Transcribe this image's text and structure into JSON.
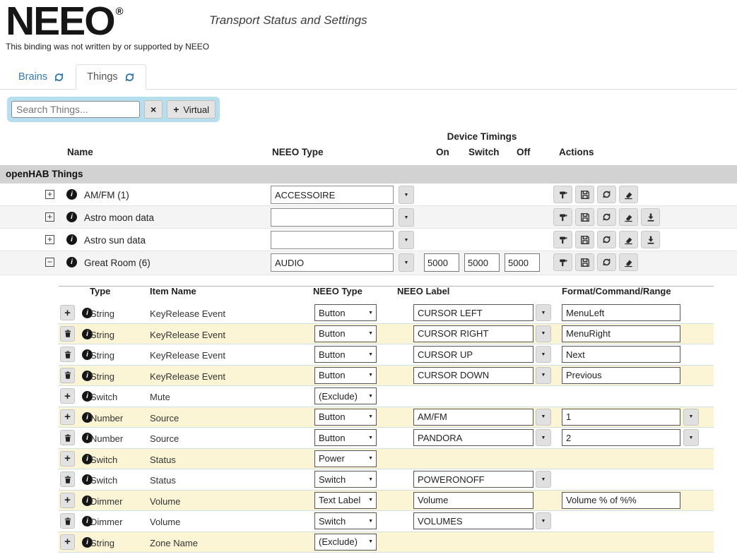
{
  "header": {
    "logo": "NEEO",
    "registered": "®",
    "subtitle": "Transport Status and Settings",
    "disclaimer": "This binding was not written by or supported by NEEO"
  },
  "tabs": {
    "brains": "Brains",
    "things": "Things"
  },
  "toolbar": {
    "search_placeholder": "Search Things...",
    "virtual_label": "Virtual"
  },
  "icons": {
    "add": "+",
    "clear": "×",
    "caret": "▼",
    "info": "i",
    "expand": "+",
    "collapse": "−",
    "action_icons": [
      "hammer-icon",
      "save-icon",
      "refresh-icon",
      "eraser-icon",
      "download-icon"
    ]
  },
  "things_table": {
    "headers": {
      "name": "Name",
      "neeo_type": "NEEO Type",
      "device_timings": "Device Timings",
      "on": "On",
      "switch": "Switch",
      "off": "Off",
      "actions": "Actions"
    },
    "section_label": "openHAB Things",
    "rows": [
      {
        "toggle": "+",
        "name": "AM/FM (1)",
        "neeo_type": "ACCESSOIRE",
        "has_download": false
      },
      {
        "toggle": "+",
        "name": "Astro moon data",
        "neeo_type": "",
        "has_download": true
      },
      {
        "toggle": "+",
        "name": "Astro sun data",
        "neeo_type": "",
        "has_download": true
      },
      {
        "toggle": "−",
        "name": "Great Room (6)",
        "neeo_type": "AUDIO",
        "has_download": false,
        "timing_on": "5000",
        "timing_switch": "5000",
        "timing_off": "5000"
      }
    ]
  },
  "channels_table": {
    "headers": {
      "type": "Type",
      "item_name": "Item Name",
      "neeo_type": "NEEO Type",
      "neeo_label": "NEEO Label",
      "format": "Format/Command/Range"
    },
    "rows": [
      {
        "action": "add",
        "type": "String",
        "item_name": "KeyRelease Event",
        "neeo_type": "Button",
        "neeo_label": "CURSOR LEFT",
        "label_dropdown": true,
        "format": "MenuLeft",
        "format_dropdown": false
      },
      {
        "action": "delete",
        "type": "String",
        "item_name": "KeyRelease Event",
        "neeo_type": "Button",
        "neeo_label": "CURSOR RIGHT",
        "label_dropdown": true,
        "format": "MenuRight",
        "format_dropdown": false
      },
      {
        "action": "delete",
        "type": "String",
        "item_name": "KeyRelease Event",
        "neeo_type": "Button",
        "neeo_label": "CURSOR UP",
        "label_dropdown": true,
        "format": "Next",
        "format_dropdown": false
      },
      {
        "action": "delete",
        "type": "String",
        "item_name": "KeyRelease Event",
        "neeo_type": "Button",
        "neeo_label": "CURSOR DOWN",
        "label_dropdown": true,
        "format": "Previous",
        "format_dropdown": false
      },
      {
        "action": "add",
        "type": "Switch",
        "item_name": "Mute",
        "neeo_type": "(Exclude)",
        "neeo_label": null,
        "label_dropdown": false,
        "format": null,
        "format_dropdown": false
      },
      {
        "action": "add",
        "type": "Number",
        "item_name": "Source",
        "neeo_type": "Button",
        "neeo_label": "AM/FM",
        "label_dropdown": true,
        "format": "1",
        "format_dropdown": true
      },
      {
        "action": "delete",
        "type": "Number",
        "item_name": "Source",
        "neeo_type": "Button",
        "neeo_label": "PANDORA",
        "label_dropdown": true,
        "format": "2",
        "format_dropdown": true
      },
      {
        "action": "add",
        "type": "Switch",
        "item_name": "Status",
        "neeo_type": "Power",
        "neeo_label": null,
        "label_dropdown": false,
        "format": null,
        "format_dropdown": false
      },
      {
        "action": "delete",
        "type": "Switch",
        "item_name": "Status",
        "neeo_type": "Switch",
        "neeo_label": "POWERONOFF",
        "label_dropdown": true,
        "format": null,
        "format_dropdown": false
      },
      {
        "action": "add",
        "type": "Dimmer",
        "item_name": "Volume",
        "neeo_type": "Text Label",
        "neeo_label": "Volume",
        "label_dropdown": false,
        "format": "Volume % of %%",
        "format_dropdown": false
      },
      {
        "action": "delete",
        "type": "Dimmer",
        "item_name": "Volume",
        "neeo_type": "Switch",
        "neeo_label": "VOLUMES",
        "label_dropdown": true,
        "format": null,
        "format_dropdown": false
      },
      {
        "action": "add",
        "type": "String",
        "item_name": "Zone Name",
        "neeo_type": "(Exclude)",
        "neeo_label": null,
        "label_dropdown": false,
        "format": null,
        "format_dropdown": false
      }
    ]
  },
  "colors": {
    "accent_blue": "#337ab7",
    "search_bg": "#b5dfee",
    "section_bg": "#d2d2d2",
    "row_highlight": "#fbf5d6",
    "row_alt_gray": "#f4f4f4"
  }
}
